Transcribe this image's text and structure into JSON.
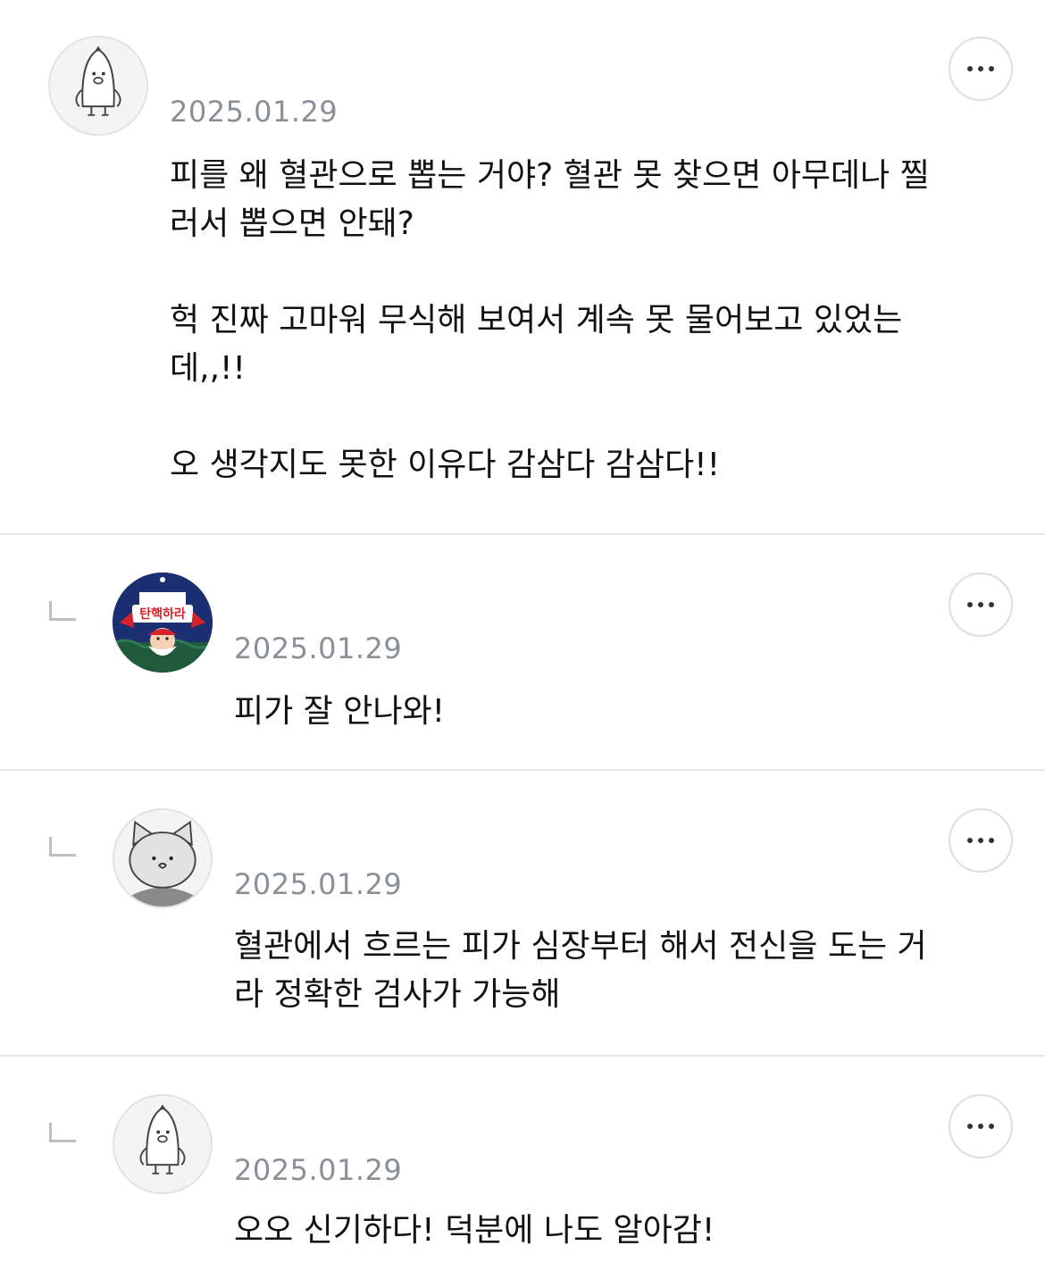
{
  "comments": [
    {
      "avatar": "penguin-avatar",
      "date": "2025.01.29",
      "text": "피를 왜 혈관으로 뽑는 거야? 혈관 못 찾으면 아무데나 찔\n러서 뽑으면 안돼?\n\n헉 진짜 고마워 무식해 보여서 계속 못 물어보고 있었는\n데,,!!\n\n오 생각지도 못한 이유다 감삼다 감삼다!!",
      "more_icon": "more-horizontal-icon"
    },
    {
      "reply": true,
      "avatar": "santa-avatar",
      "date": "2025.01.29",
      "text": "피가 잘 안나와!",
      "more_icon": "more-horizontal-icon"
    },
    {
      "reply": true,
      "avatar": "cat-avatar",
      "date": "2025.01.29",
      "text": "혈관에서 흐르는 피가 심장부터 해서 전신을 도는 거\n라 정확한 검사가 가능해",
      "more_icon": "more-horizontal-icon"
    },
    {
      "reply": true,
      "avatar": "penguin-avatar",
      "date": "2025.01.29",
      "text": "오오 신기하다! 덕분에 나도 알아감!",
      "more_icon": "more-horizontal-icon"
    }
  ],
  "colors": {
    "date": "#8b8f98",
    "divider": "#e6e6e6",
    "text": "#111111"
  }
}
